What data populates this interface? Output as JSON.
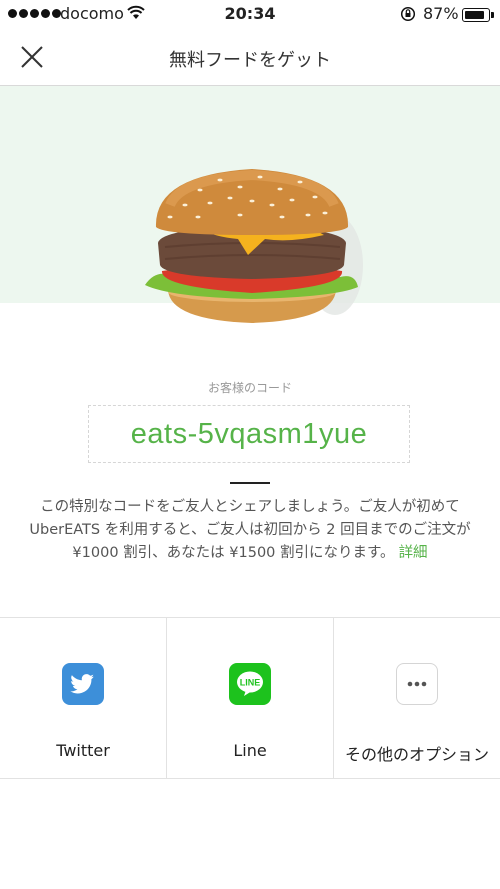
{
  "status_bar": {
    "carrier": "docomo",
    "time": "20:34",
    "battery_percent": "87%",
    "battery_level": 0.87
  },
  "nav": {
    "title": "無料フードをゲット",
    "close_icon": "close-icon"
  },
  "hero": {
    "image": "burger-illustration",
    "background_color": "#edf7ef"
  },
  "promo": {
    "label": "お客様のコード",
    "code": "eats-5vqasm1yue",
    "description": "この特別なコードをご友人とシェアしましょう。ご友人が初めて UberEATS を利用すると、ご友人は初回から 2 回目までのご注文が ¥1000 割引、あなたは ¥1500 割引になります。",
    "details_link": "詳細",
    "accent_color": "#56b349"
  },
  "share": {
    "options": [
      {
        "label": "Twitter",
        "icon": "twitter-icon"
      },
      {
        "label": "Line",
        "icon": "line-icon"
      },
      {
        "label": "その他のオプション",
        "icon": "more-icon"
      }
    ]
  }
}
